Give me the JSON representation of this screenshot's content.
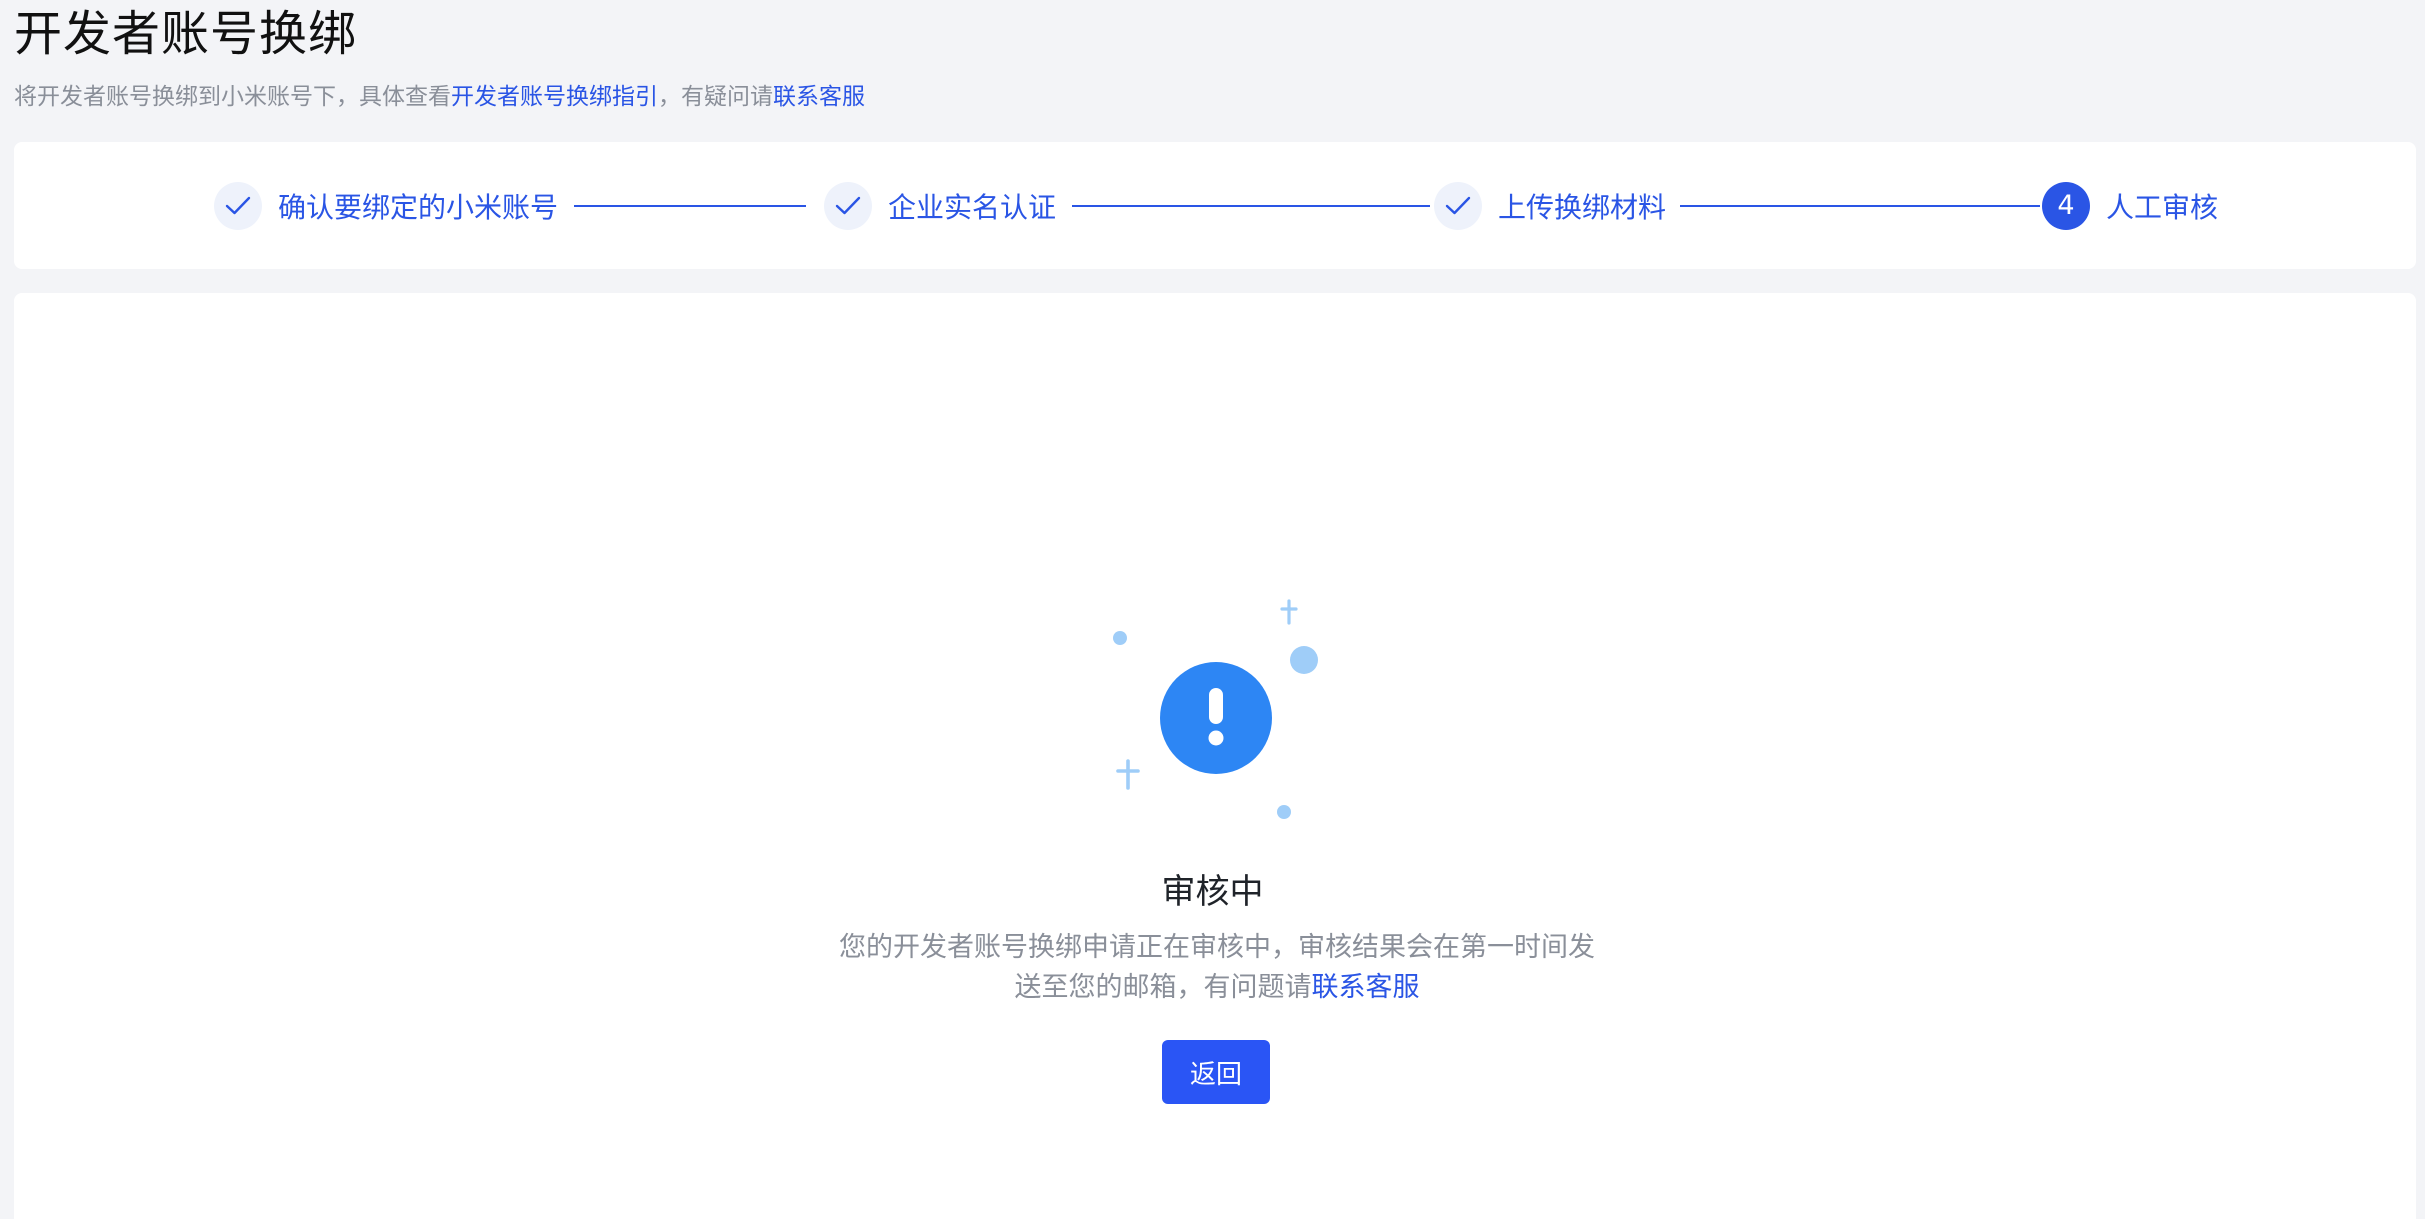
{
  "header": {
    "title": "开发者账号换绑",
    "subtitle_prefix": "将开发者账号换绑到小米账号下，具体查看",
    "subtitle_guide_link": "开发者账号换绑指引",
    "subtitle_middle": "，有疑问请",
    "subtitle_support_link": "联系客服"
  },
  "steps": [
    {
      "label": "确认要绑定的小米账号",
      "status": "done"
    },
    {
      "label": "企业实名认证",
      "status": "done"
    },
    {
      "label": "上传换绑材料",
      "status": "done"
    },
    {
      "label": "人工审核",
      "status": "active",
      "number": "4"
    }
  ],
  "result": {
    "icon": "exclamation-icon",
    "title": "审核中",
    "desc_line1": "您的开发者账号换绑申请正在审核中，审核结果会在第一时间发",
    "desc_line2_prefix": "送至您的邮箱，有问题请",
    "desc_support_link": "联系客服",
    "back_label": "返回"
  },
  "colors": {
    "accent": "#2a55e5",
    "button": "#2a55f5",
    "illustration_main": "#2d86f4",
    "illustration_light": "#9fcdf8"
  }
}
